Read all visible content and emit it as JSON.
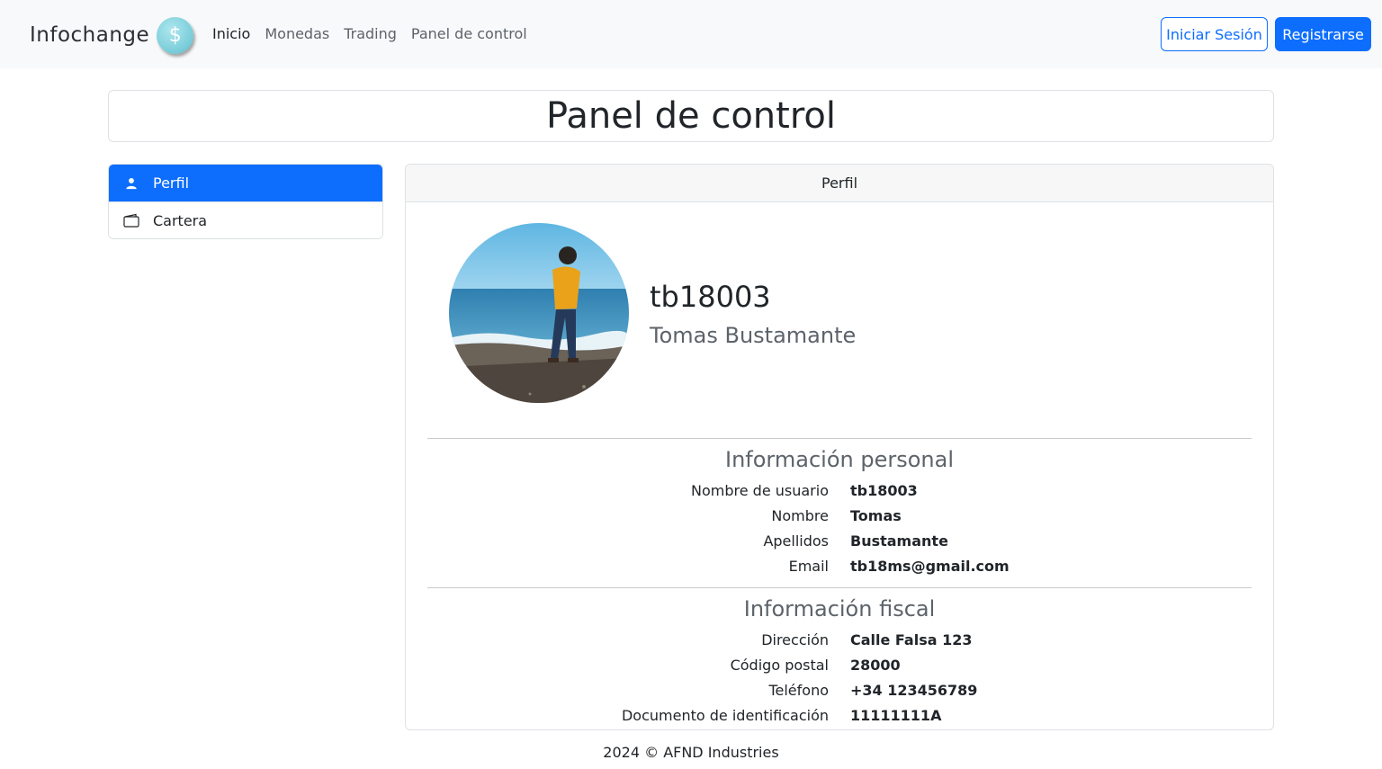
{
  "brand": {
    "name": "Infochange",
    "logo_symbol": "$"
  },
  "nav": {
    "links": [
      {
        "label": "Inicio",
        "active": true
      },
      {
        "label": "Monedas",
        "active": false
      },
      {
        "label": "Trading",
        "active": false
      },
      {
        "label": "Panel de control",
        "active": false
      }
    ],
    "login_label": "Iniciar Sesión",
    "register_label": "Registrarse"
  },
  "page": {
    "title": "Panel de control"
  },
  "sidebar": {
    "items": [
      {
        "label": "Perfil",
        "icon": "person-icon",
        "active": true
      },
      {
        "label": "Cartera",
        "icon": "wallet-icon",
        "active": false
      }
    ]
  },
  "profile": {
    "header": "Perfil",
    "username": "tb18003",
    "fullname": "Tomas Bustamante",
    "personal": {
      "title": "Información personal",
      "rows": [
        {
          "label": "Nombre de usuario",
          "value": "tb18003"
        },
        {
          "label": "Nombre",
          "value": "Tomas"
        },
        {
          "label": "Apellidos",
          "value": "Bustamante"
        },
        {
          "label": "Email",
          "value": "tb18ms@gmail.com"
        }
      ]
    },
    "fiscal": {
      "title": "Información fiscal",
      "rows": [
        {
          "label": "Dirección",
          "value": "Calle Falsa 123"
        },
        {
          "label": "Código postal",
          "value": "28000"
        },
        {
          "label": "Teléfono",
          "value": "+34 123456789"
        },
        {
          "label": "Documento de identificación",
          "value": "11111111A"
        }
      ]
    }
  },
  "footer": {
    "text": "2024 © AFND Industries"
  },
  "colors": {
    "primary": "#0d6efd",
    "navbar_bg": "#f8f9fa",
    "muted": "#5c636a"
  }
}
